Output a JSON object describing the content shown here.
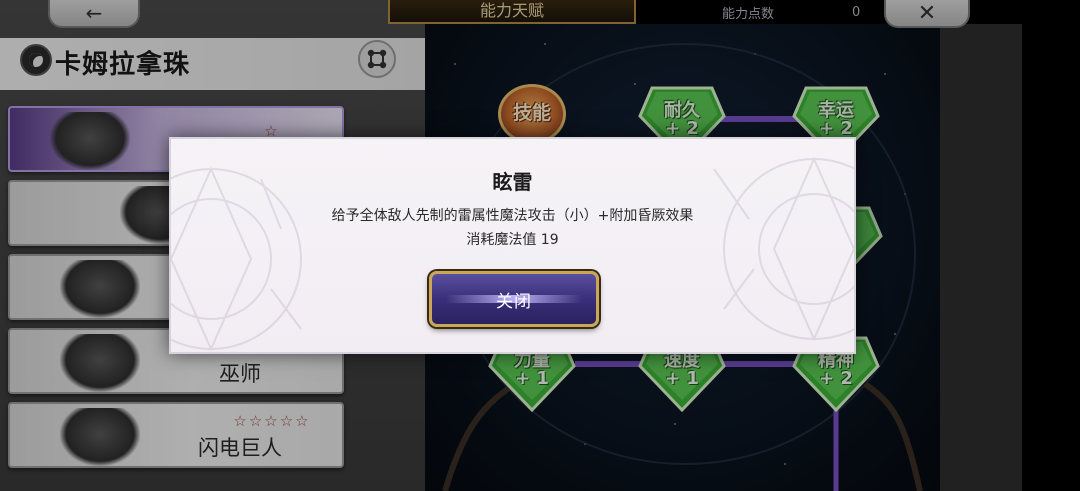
{
  "topbar": {
    "back_icon": "arrow-left-icon",
    "title": "能力天赋",
    "points_label": "能力点数",
    "points_value": "0",
    "close_icon": "close-x-icon"
  },
  "character": {
    "name": "卡姆拉拿珠",
    "logo_icon": "character-emblem-icon",
    "swap_icon": "swap-nodes-icon"
  },
  "jobs": [
    {
      "stars": "☆",
      "name": ""
    },
    {
      "stars": "",
      "name": ""
    },
    {
      "stars": "",
      "name": ""
    },
    {
      "stars": "",
      "name": "巫师"
    },
    {
      "stars": "☆☆☆☆☆",
      "name": "闪电巨人"
    }
  ],
  "board": {
    "skill_label": "技能",
    "nodes": [
      {
        "label": "耐久",
        "value": "+ 2"
      },
      {
        "label": "幸运",
        "value": "+ 2"
      },
      {
        "label": "力量",
        "value": "+ 1"
      },
      {
        "label": "速度",
        "value": "+ 1"
      },
      {
        "label": "精神",
        "value": "+ 2"
      }
    ],
    "colors": {
      "node_green": "#3fb33a",
      "line_purple": "#7b52c8",
      "skill_orange": "#c66a2e"
    }
  },
  "modal": {
    "title": "眩雷",
    "description": "给予全体敌人先制的雷属性魔法攻击（小）+附加昏厥效果",
    "cost": "消耗魔法值 19",
    "close_label": "关闭"
  }
}
